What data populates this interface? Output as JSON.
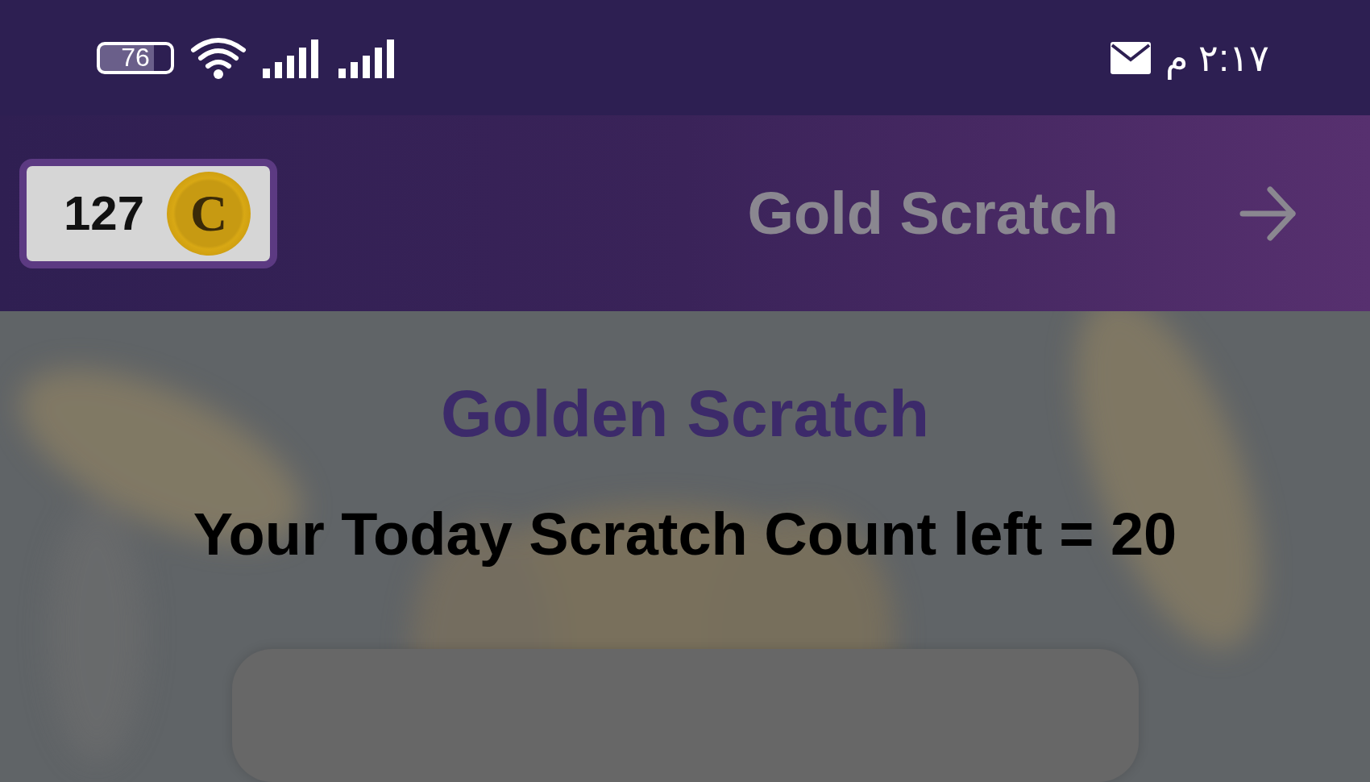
{
  "status_bar": {
    "battery": "76",
    "time": "٢:١٧ م"
  },
  "header": {
    "coins": "127",
    "coin_symbol": "C",
    "title": "Gold Scratch"
  },
  "content": {
    "heading": "Golden Scratch",
    "count_text": "Your Today Scratch Count left = 20"
  }
}
